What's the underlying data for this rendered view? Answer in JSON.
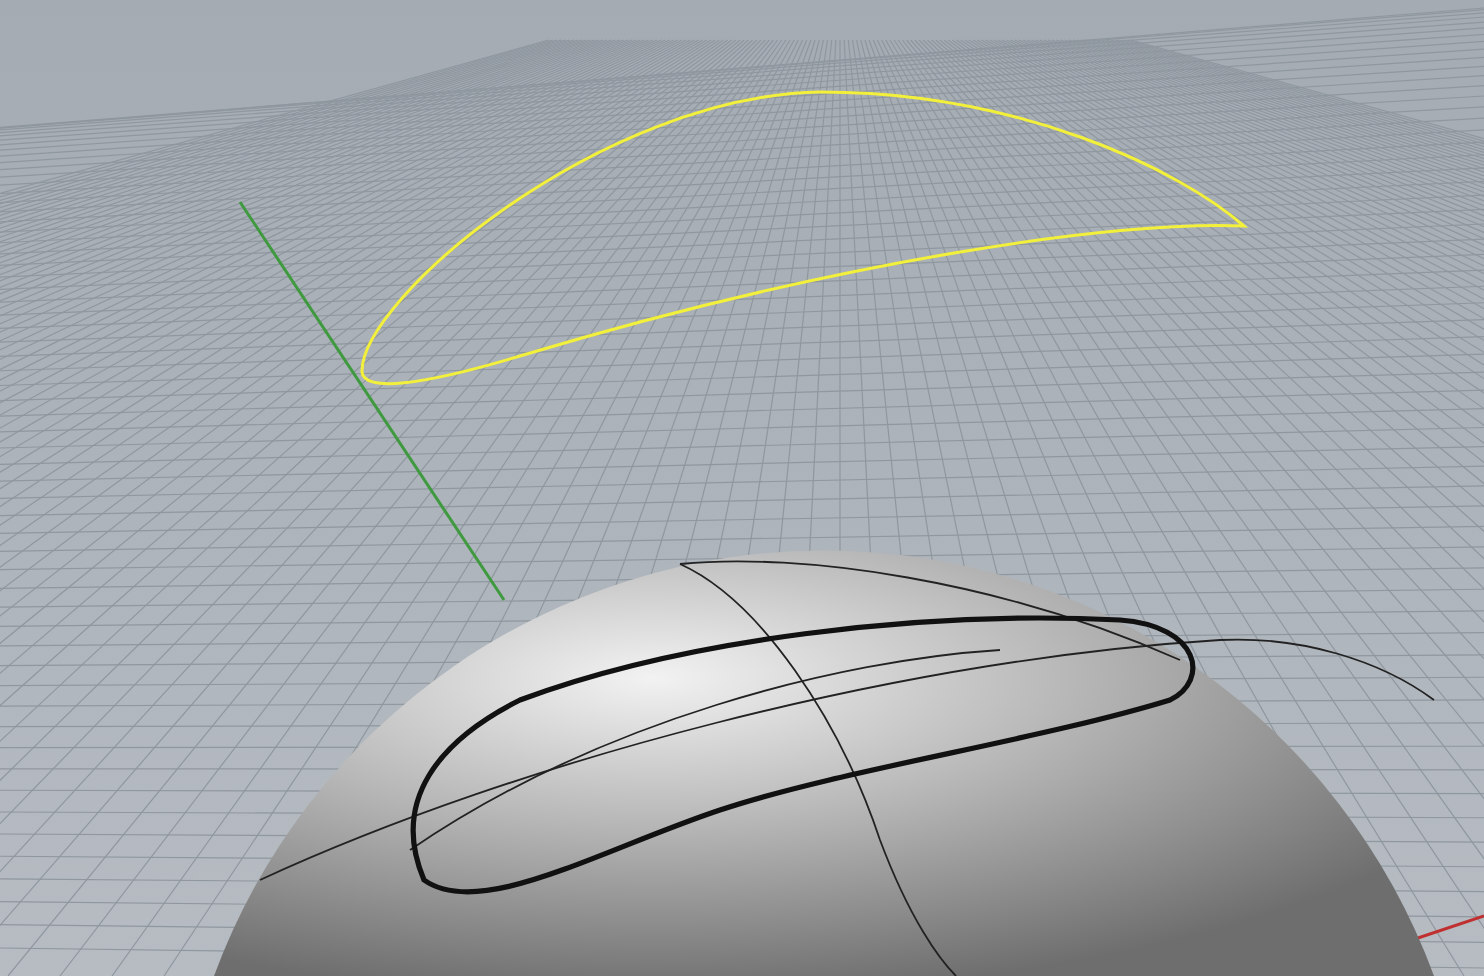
{
  "viewport": {
    "kind": "perspective",
    "curve": {
      "selected": true
    }
  }
}
